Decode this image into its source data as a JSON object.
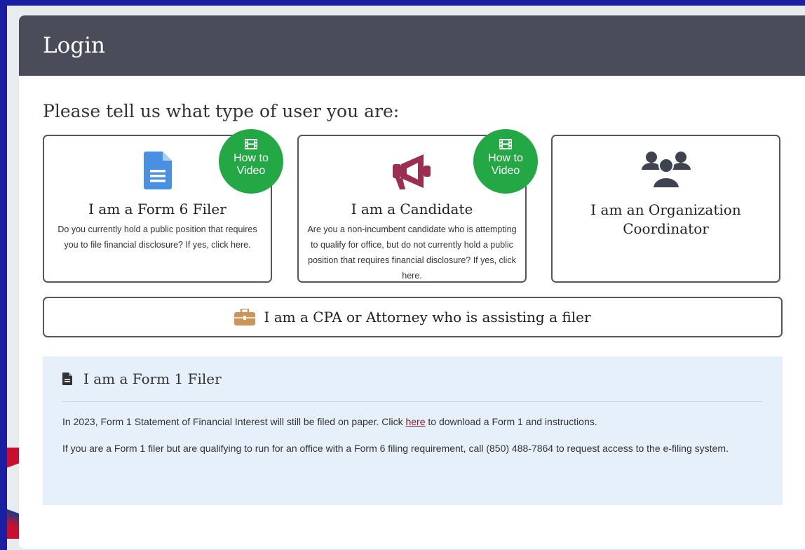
{
  "panel": {
    "title": "Login"
  },
  "prompt": "Please tell us what type of user you are:",
  "video_badge": {
    "line1": "How to",
    "line2": "Video"
  },
  "cards": [
    {
      "title": "I am a Form 6 Filer",
      "description": "Do you currently hold a public position that requires you to file financial disclosure? If yes, click here.",
      "icon": "document-icon",
      "icon_color": "#4a90e2"
    },
    {
      "title": "I am a Candidate",
      "description": "Are you a non-incumbent candidate who is attempting to qualify for office, but do not currently hold a public position that requires financial disclosure? If yes, click here.",
      "icon": "megaphone-icon",
      "icon_color": "#9b2f52"
    },
    {
      "title": "I am an Organization Coordinator",
      "icon": "users-icon",
      "icon_color": "#3f4350"
    }
  ],
  "cpa": {
    "label": "I am a CPA or Attorney who is assisting a filer",
    "icon": "briefcase-icon",
    "icon_color": "#c8955a"
  },
  "form1": {
    "heading": "I am a Form 1 Filer",
    "p1_before": "In 2023, Form 1 Statement of Financial Interest will still be filed on paper. Click ",
    "p1_link": "here",
    "p1_after": " to download a Form 1 and instructions.",
    "p2": "If you are a Form 1 filer but are qualifying to run for an office with a Form 6 filing requirement, call (850) 488-7864 to request access to the e-filing system."
  },
  "colors": {
    "header_bg": "#4a4c5a",
    "badge_green": "#23a845",
    "info_bg": "#e6f0fa",
    "link": "#8a1c2b",
    "frame_blue": "#1a1ea0"
  }
}
